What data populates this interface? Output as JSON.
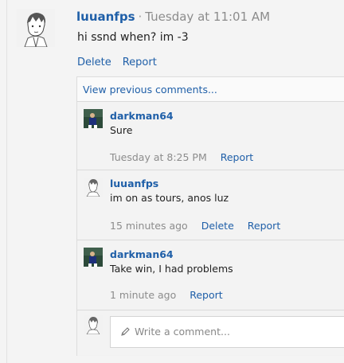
{
  "post": {
    "author": "luuanfps",
    "separator": "·",
    "time": "Tuesday at 11:01 AM",
    "text": "hi ssnd when? im -3",
    "actions": {
      "delete": "Delete",
      "report": "Report"
    }
  },
  "thread": {
    "view_previous": "View previous comments...",
    "comments": [
      {
        "author": "darkman64",
        "text": "Sure",
        "time": "Tuesday at 8:25 PM",
        "report": "Report"
      },
      {
        "author": "luuanfps",
        "text": "im on as tours, anos luz",
        "time": "15 minutes ago",
        "delete": "Delete",
        "report": "Report"
      },
      {
        "author": "darkman64",
        "text": "Take win, I had problems",
        "time": "1 minute ago",
        "report": "Report"
      }
    ],
    "composer": {
      "placeholder": "Write a comment..."
    }
  },
  "icons": {
    "pencil": "pencil-icon"
  },
  "colors": {
    "link": "#1f5fa8",
    "muted": "#8c8c8c"
  }
}
